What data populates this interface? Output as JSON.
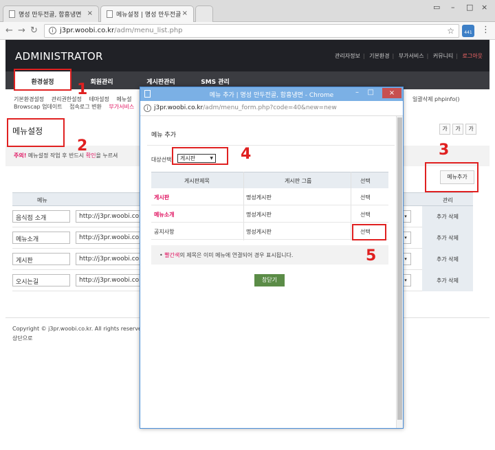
{
  "browser": {
    "tabs": [
      {
        "label": "명성 만두전골, 함흥냉면",
        "active": false
      },
      {
        "label": "메뉴설정 | 명성 만두전골",
        "active": true
      }
    ],
    "url_host": "j3pr.woobi.co.kr",
    "url_path": "/adm/menu_list.php",
    "ext_badge": "441"
  },
  "admin": {
    "logo": "ADMINISTRATOR",
    "top_links": [
      "관리자정보",
      "기본환경",
      "부가서비스",
      "커뮤니티",
      "로그아웃"
    ],
    "gnb": [
      "환경설정",
      "회원관리",
      "게시판관리",
      "SMS 관리"
    ],
    "subnav_line1": [
      "기본환경설정",
      "관리권한설정",
      "테마설정",
      "메뉴설"
    ],
    "subnav_right": [
      "일괄삭제",
      "phpinfo()"
    ],
    "subnav_line2": [
      "Browscap 업데이트",
      "접속로그 변환",
      "부가서비스"
    ],
    "page_title": "메뉴설정",
    "font_sizes": [
      "가",
      "가",
      "가"
    ],
    "notice_warn": "주의!",
    "notice_text1": "메뉴설정 작업 후 반드시",
    "notice_ok": "확인",
    "notice_text2": "을 누르셔",
    "add_menu": "메뉴추가",
    "table_head": {
      "menu": "메뉴",
      "manage": "관리"
    },
    "rows": [
      {
        "name": "음식점 소개",
        "url": "http://j3pr.woobi.co.",
        "manage": "추가 삭제"
      },
      {
        "name": "메뉴소개",
        "url": "http://j3pr.woobi.co.",
        "manage": "추가 삭제"
      },
      {
        "name": "게시판",
        "url": "http://j3pr.woobi.co.",
        "manage": "추가 삭제"
      },
      {
        "name": "오시는길",
        "url": "http://j3pr.woobi.co.",
        "manage": "추가 삭제"
      }
    ],
    "copyright": "Copyright © j3pr.woobi.co.kr. All rights reserved",
    "to_top": "상단으로"
  },
  "popup": {
    "title": "메뉴 추가 | 명성 만두전골, 함흥냉면 - Chrome",
    "url_host": "j3pr.woobi.co.kr",
    "url_path": "/adm/menu_form.php?code=40&new=new",
    "heading": "메뉴 추가",
    "select_label": "대상선택",
    "select_value": "게시판",
    "cols": [
      "게시판제목",
      "게시판 그룹",
      "선택"
    ],
    "rows": [
      {
        "title": "게시판",
        "group": "명성게시판",
        "select": "선택",
        "red": true
      },
      {
        "title": "메뉴소개",
        "group": "명성게시판",
        "select": "선택",
        "red": true
      },
      {
        "title": "공지사항",
        "group": "명성게시판",
        "select": "선택",
        "red": false
      }
    ],
    "note_red": "빨간색",
    "note_text": "의 제목은 이미 메뉴에 연결되어 경우 표시됩니다.",
    "close_button": "창닫기"
  },
  "annotations": [
    "1",
    "2",
    "3",
    "4",
    "5"
  ],
  "colors": {
    "annotation": "#e02020",
    "accent": "#e0115f",
    "header": "#202126"
  }
}
